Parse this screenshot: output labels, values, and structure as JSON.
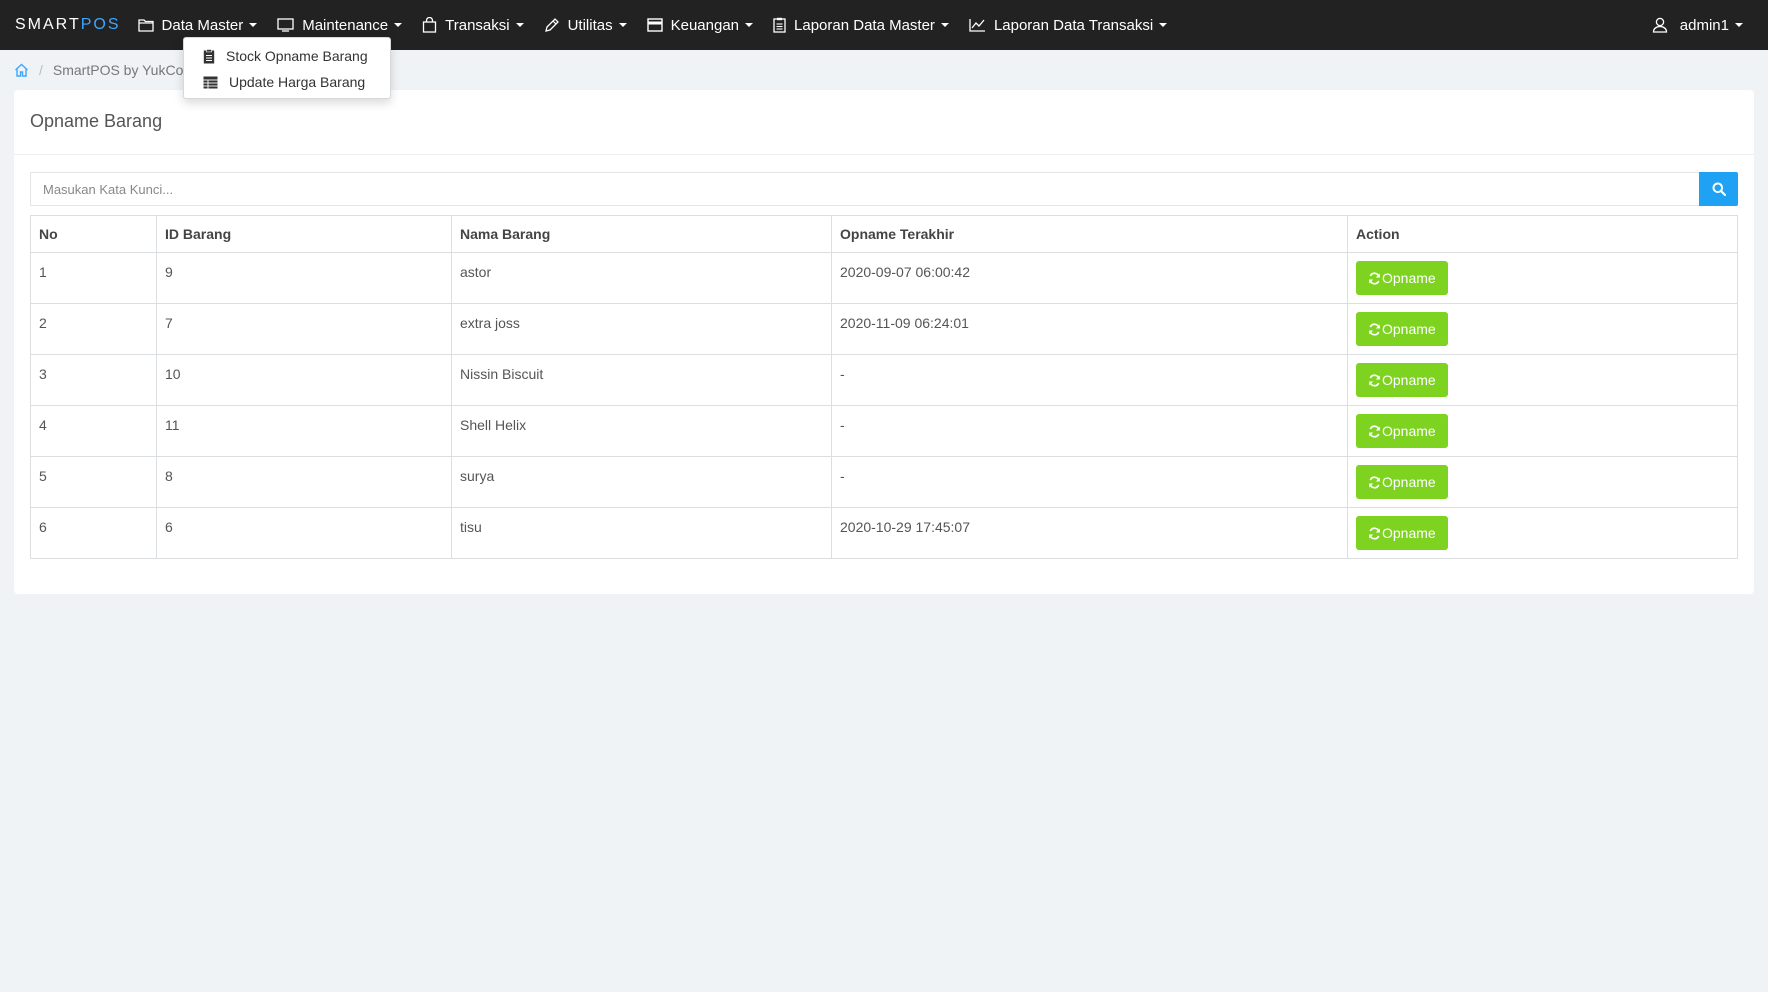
{
  "navbar": {
    "brand_main": "SMART",
    "brand_accent": "POS",
    "menus": [
      {
        "label": "Data Master",
        "icon": "folder-icon"
      },
      {
        "label": "Maintenance",
        "icon": "monitor-icon"
      },
      {
        "label": "Transaksi",
        "icon": "shopping-bag-icon"
      },
      {
        "label": "Utilitas",
        "icon": "pen-icon"
      },
      {
        "label": "Keuangan",
        "icon": "credit-card-icon"
      },
      {
        "label": "Laporan Data Master",
        "icon": "clipboard-icon"
      },
      {
        "label": "Laporan Data Transaksi",
        "icon": "line-chart-icon"
      }
    ],
    "user": "admin1"
  },
  "breadcrumb": {
    "home_icon": "home-icon",
    "current": "SmartPOS by YukCoding"
  },
  "dropdown": {
    "items": [
      {
        "label": "Stock Opname Barang",
        "icon": "clipboard-icon"
      },
      {
        "label": "Update Harga Barang",
        "icon": "table-icon"
      }
    ]
  },
  "panel": {
    "title": "Opname Barang",
    "search_placeholder": "Masukan Kata Kunci...",
    "columns": [
      "No",
      "ID Barang",
      "Nama Barang",
      "Opname Terakhir",
      "Action"
    ],
    "rows": [
      {
        "no": "1",
        "id": "9",
        "nama": "astor",
        "opname": "2020-09-07 06:00:42",
        "action": "Opname"
      },
      {
        "no": "2",
        "id": "7",
        "nama": "extra joss",
        "opname": "2020-11-09 06:24:01",
        "action": "Opname"
      },
      {
        "no": "3",
        "id": "10",
        "nama": "Nissin Biscuit",
        "opname": "-",
        "action": "Opname"
      },
      {
        "no": "4",
        "id": "11",
        "nama": "Shell Helix",
        "opname": "-",
        "action": "Opname"
      },
      {
        "no": "5",
        "id": "8",
        "nama": "surya",
        "opname": "-",
        "action": "Opname"
      },
      {
        "no": "6",
        "id": "6",
        "nama": "tisu",
        "opname": "2020-10-29 17:45:07",
        "action": "Opname"
      }
    ]
  },
  "colors": {
    "navbar_bg": "#222222",
    "brand_accent": "#3ea6ff",
    "search_button": "#1fa2f3",
    "opname_button": "#7ed321",
    "page_bg": "#f0f3f6"
  }
}
